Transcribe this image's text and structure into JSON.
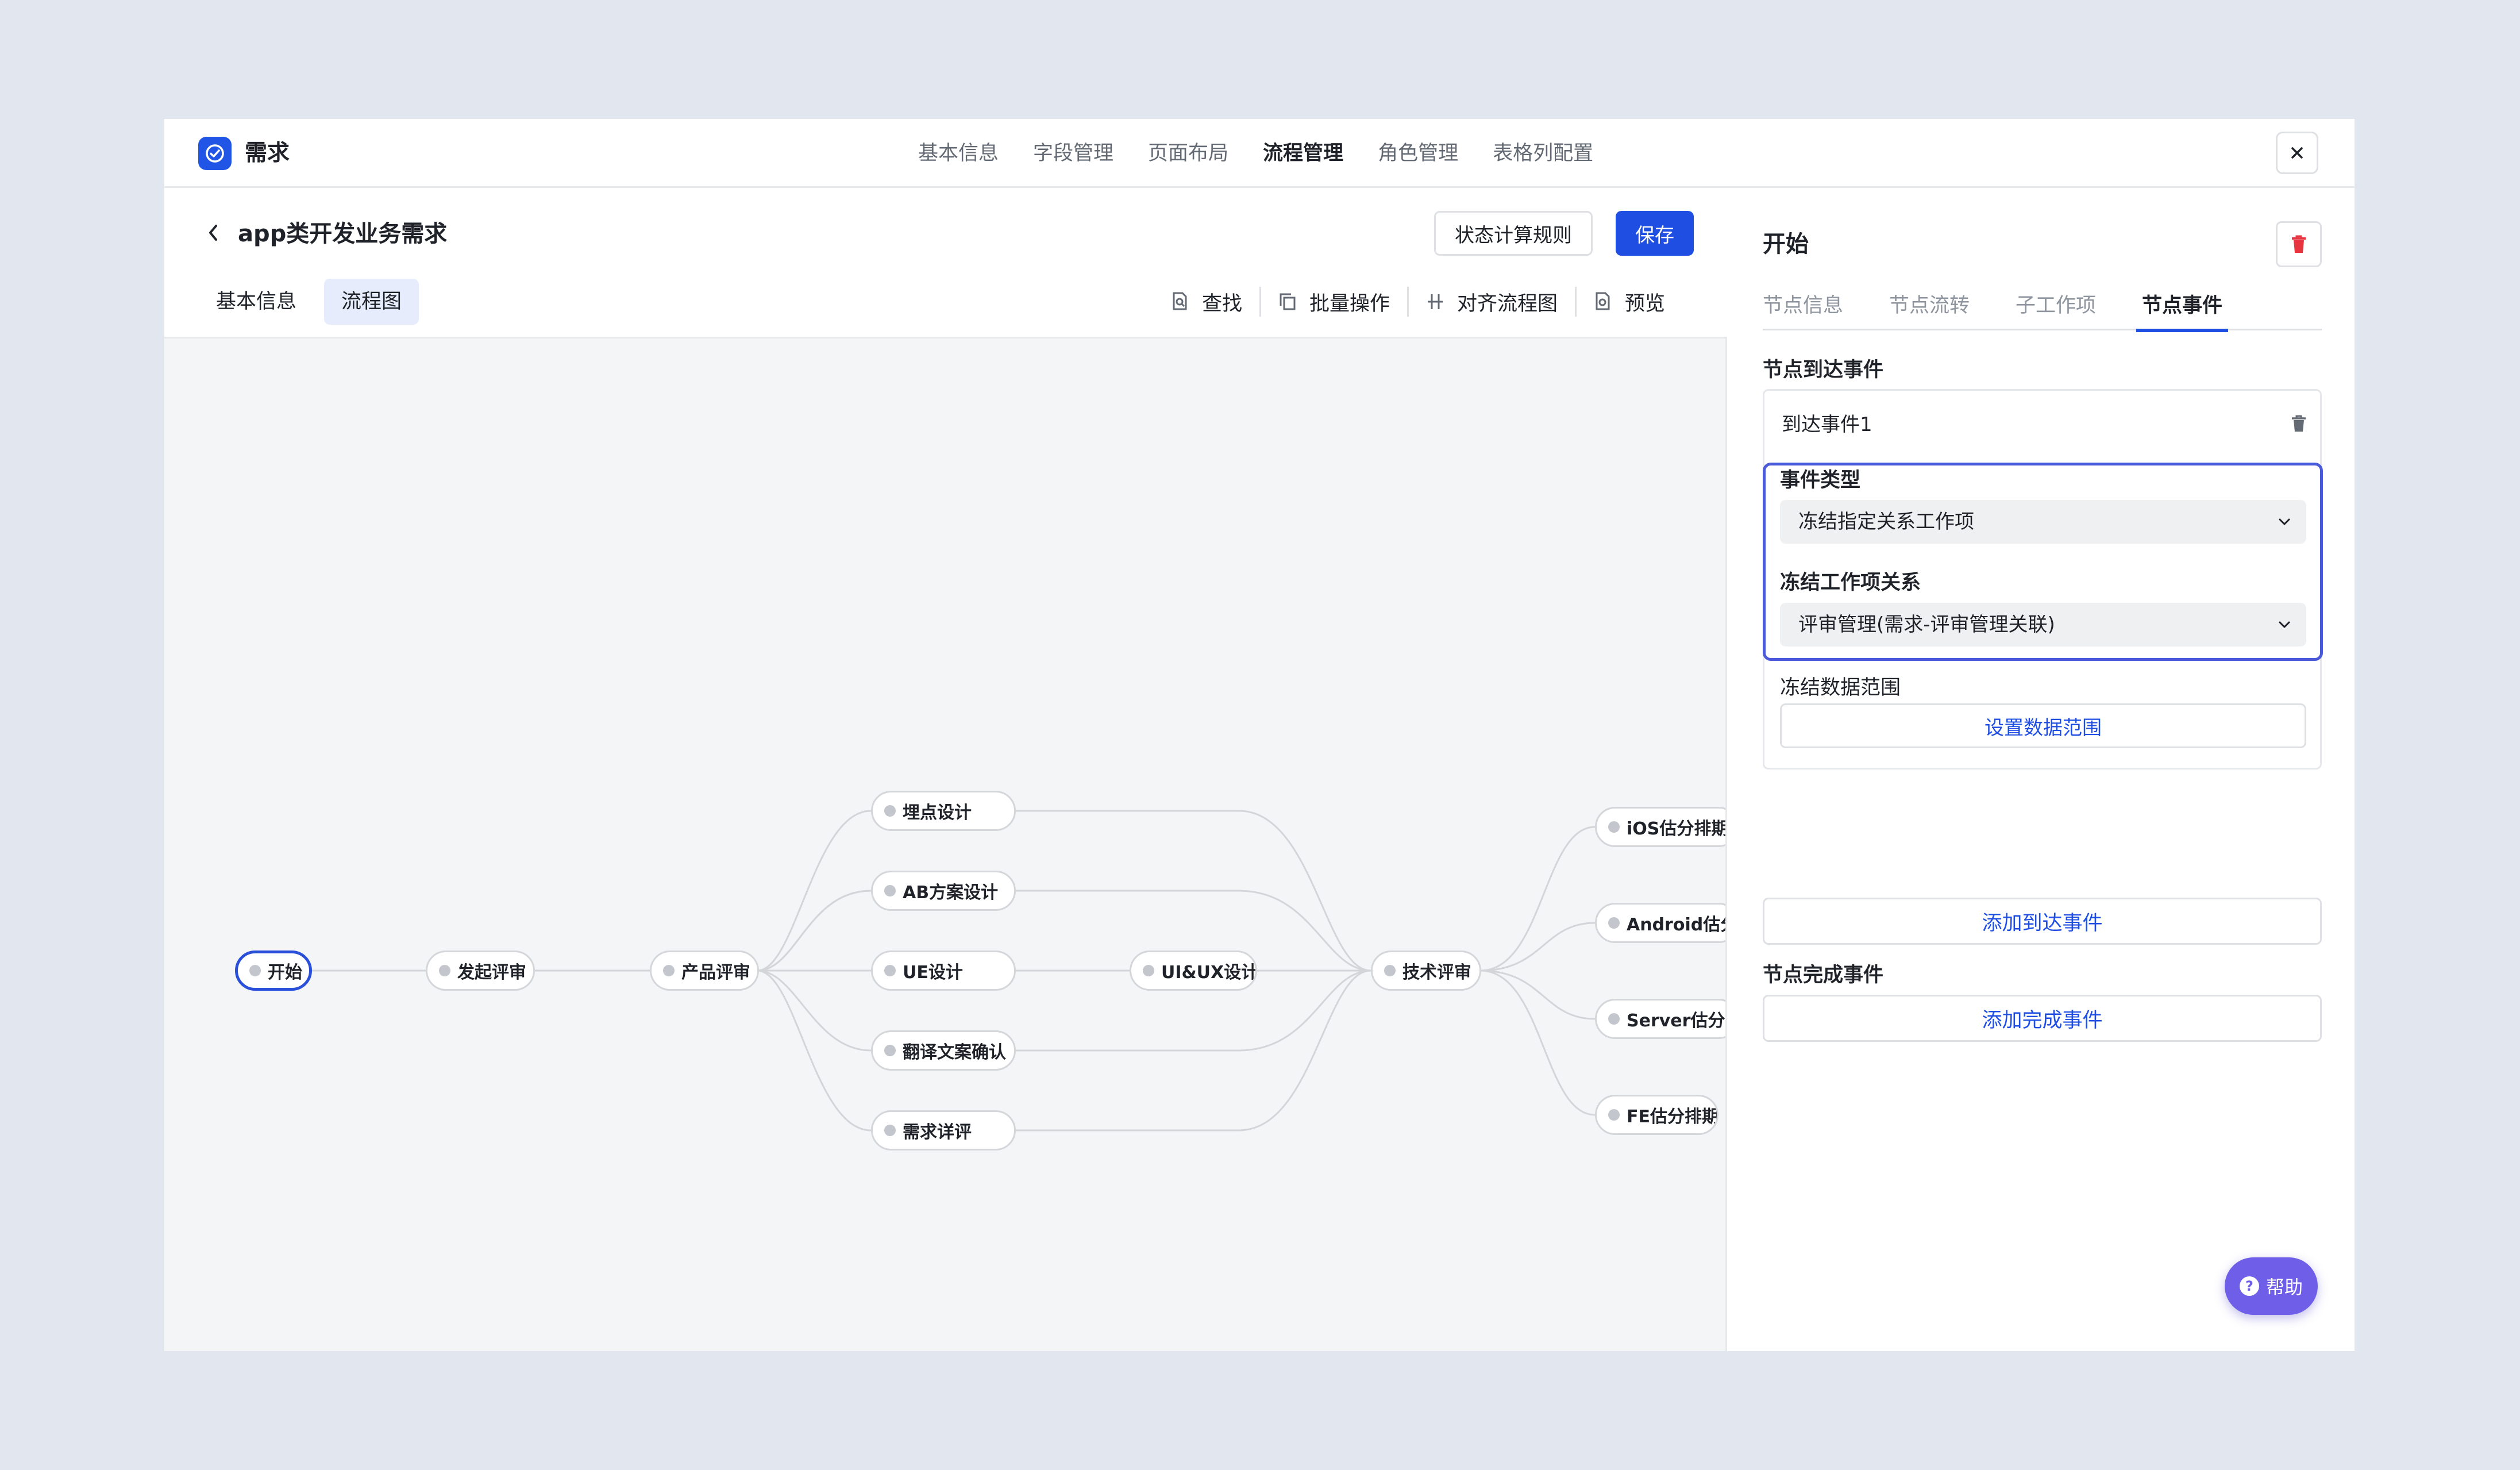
{
  "app": {
    "title": "需求"
  },
  "top_tabs": [
    {
      "label": "基本信息"
    },
    {
      "label": "字段管理"
    },
    {
      "label": "页面布局"
    },
    {
      "label": "流程管理",
      "active": true
    },
    {
      "label": "角色管理"
    },
    {
      "label": "表格列配置"
    }
  ],
  "editor": {
    "title": "app类开发业务需求",
    "rule_button": "状态计算规则",
    "save_button": "保存",
    "sub_tabs": [
      "基本信息",
      "流程图"
    ],
    "toolbar": {
      "find": "查找",
      "batch": "批量操作",
      "align": "对齐流程图",
      "preview": "预览"
    }
  },
  "flow": {
    "nodes": [
      "开始",
      "发起评审",
      "产品评审",
      "埋点设计",
      "AB方案设计",
      "UE设计",
      "翻译文案确认",
      "需求详评",
      "UI&UX设计",
      "技术评审",
      "iOS估分排期",
      "Android估分排期",
      "Server估分排期",
      "FE估分排期"
    ],
    "selected": "开始"
  },
  "panel": {
    "title": "开始",
    "tabs": [
      "节点信息",
      "节点流转",
      "子工作项",
      "节点事件"
    ],
    "active_tab": "节点事件",
    "arrive_section": "节点到达事件",
    "event_name": "到达事件1",
    "event_type_label": "事件类型",
    "event_type_value": "冻结指定关系工作项",
    "relation_label": "冻结工作项关系",
    "relation_value": "评审管理(需求-评审管理关联)",
    "range_label": "冻结数据范围",
    "range_button": "设置数据范围",
    "add_arrive_button": "添加到达事件",
    "complete_section": "节点完成事件",
    "add_complete_button": "添加完成事件"
  },
  "help": {
    "label": "帮助"
  },
  "colors": {
    "accent": "#1f4ee3",
    "selected_node": "#2a4fd8",
    "help": "#6e5ee8",
    "danger": "#e8343e"
  }
}
